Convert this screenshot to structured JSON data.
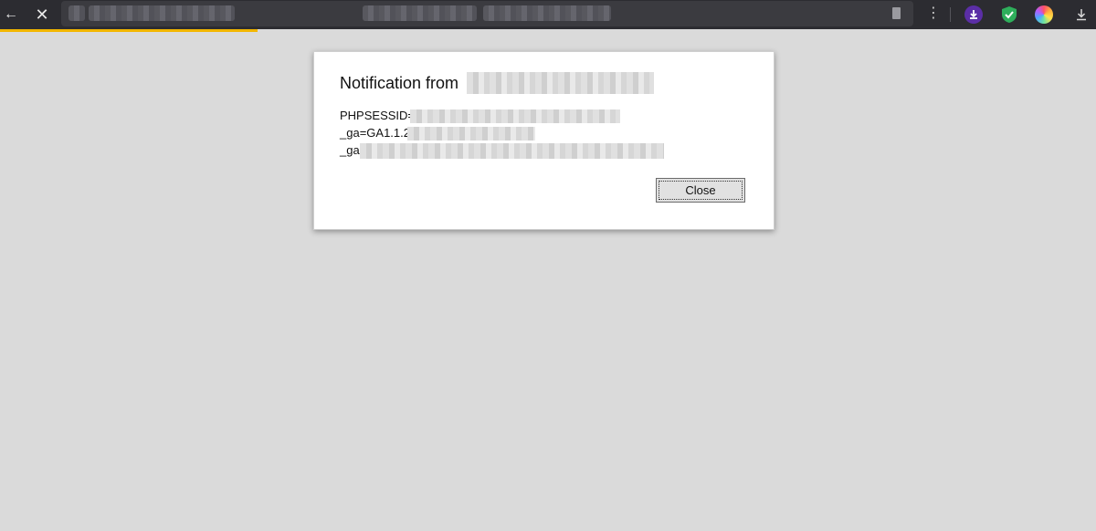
{
  "browser": {
    "back_glyph": "←",
    "close_glyph": "✕",
    "menu_glyph": "⋮",
    "load_progress_percent": 23.5,
    "accent_color": "#f2b600",
    "icons": [
      "back-arrow-icon",
      "close-icon",
      "more-menu-icon",
      "download-extension-icon",
      "shield-extension-icon",
      "color-extension-icon",
      "downloads-icon"
    ]
  },
  "dialog": {
    "title_prefix": "Notification from",
    "lines": [
      "PHPSESSID=dc",
      "_ga=GA1.1.274",
      "_ga"
    ],
    "close_label": "Close"
  }
}
